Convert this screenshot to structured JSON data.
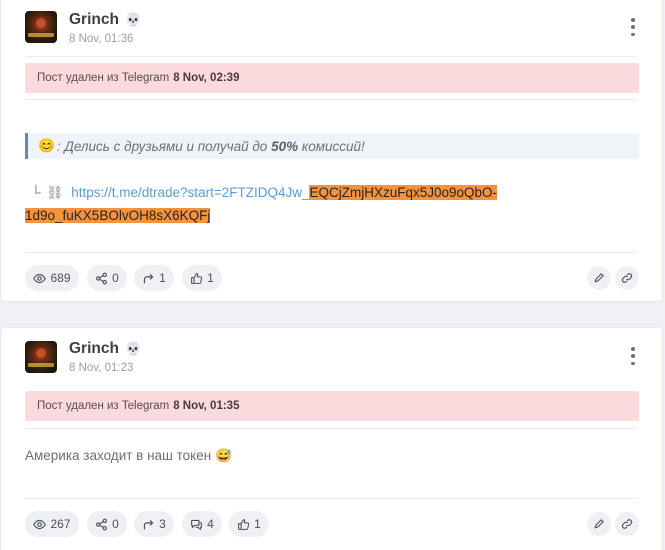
{
  "posts": [
    {
      "author": "Grinch",
      "author_badge": "💀",
      "timestamp": "8 Nov, 01:36",
      "deleted_notice": {
        "text": "Пост удален из Telegram",
        "date": "8 Nov, 02:39"
      },
      "promo": {
        "emoji": "😊",
        "prefix": ": Делись с друзьями и получай до",
        "bold": "50%",
        "suffix": "комиссий!"
      },
      "link": {
        "corner": "└",
        "chain_icon": "⛓",
        "url_plain": "https://t.me/dtrade?start=2FTZIDQ4Jw_",
        "url_highlighted": "EQCjZmjHXzuFqx5J0o9oQbO-1d9o_fuKX5BOlvOH8sX6KQFj"
      },
      "stats": {
        "views": "689",
        "shares": "0",
        "forwards": "1",
        "likes": "1"
      }
    },
    {
      "author": "Grinch",
      "author_badge": "💀",
      "timestamp": "8 Nov, 01:23",
      "deleted_notice": {
        "text": "Пост удален из Telegram",
        "date": "8 Nov, 01:35"
      },
      "message": "Америка заходит в наш токен",
      "message_emoji": "😅",
      "stats": {
        "views": "267",
        "shares": "0",
        "forwards": "3",
        "comments": "4",
        "likes": "1"
      }
    }
  ],
  "icons": {
    "views": "eye-icon",
    "shares": "share-icon",
    "forwards": "forward-icon",
    "comments": "comments-icon",
    "likes": "thumbs-up-icon",
    "edit": "pencil-icon",
    "link": "link-icon",
    "menu": "kebab-menu-icon"
  },
  "colors": {
    "deleted_bg": "#fadadd",
    "promo_border": "#5b8fb9",
    "highlight": "#f5923e",
    "link": "#5a9ed1"
  }
}
